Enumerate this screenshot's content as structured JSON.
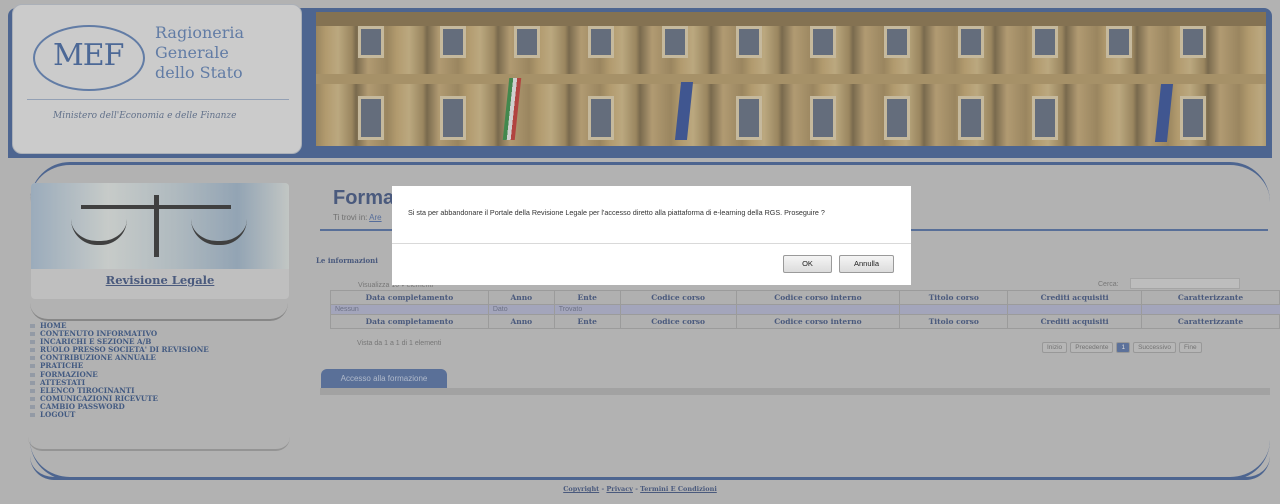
{
  "header": {
    "logo_abbr": "MEF",
    "logo_lines": [
      "Ragioneria",
      "Generale",
      "dello Stato"
    ],
    "ministry": "Ministero dell'Economia e delle Finanze"
  },
  "sidebar": {
    "title": "Revisione Legale",
    "menu": [
      "HOME",
      "CONTENUTO INFORMATIVO",
      "INCARICHI E SEZIONE A/B",
      "RUOLO PRESSO SOCIETA' DI REVISIONE",
      "CONTRIBUZIONE ANNUALE",
      "PRATICHE",
      "FORMAZIONE",
      "ATTESTATI",
      "ELENCO TIROCINANTI",
      "COMUNICAZIONI RICEVUTE",
      "CAMBIO PASSWORD",
      "LOGOUT"
    ]
  },
  "content": {
    "title": "Forma:",
    "breadcrumb_prefix": "Ti trovi in:",
    "breadcrumb_link": "Are",
    "info": "Le informazioni",
    "show_label": "Visualizza",
    "show_value": "10",
    "show_suffix": "elementi",
    "search_label": "Cerca:",
    "table": {
      "headers": [
        "Data completamento",
        "Anno",
        "Ente",
        "Codice corso",
        "Codice corso interno",
        "Titolo corso",
        "Crediti acquisiti",
        "Caratterizzante"
      ],
      "row": [
        "Nessun",
        "Dato",
        "Trovato",
        "",
        "",
        "",
        "",
        ""
      ]
    },
    "vista": "Vista da 1 a 1 di 1 elementi",
    "pager": [
      "Inizio",
      "Precedente",
      "1",
      "Successivo",
      "Fine"
    ],
    "tab_label": "Accesso alla formazione"
  },
  "footer": {
    "copyright": "Copyright",
    "privacy": "Privacy",
    "terms": "Termini E Condizioni",
    "sep": " - "
  },
  "dialog": {
    "message": "Si sta per abbandonare il Portale della Revisione Legale per l'accesso diretto alla piattaforma di e-learning della RGS. Proseguire ?",
    "ok_label": "OK",
    "cancel_label": "Annulla"
  }
}
